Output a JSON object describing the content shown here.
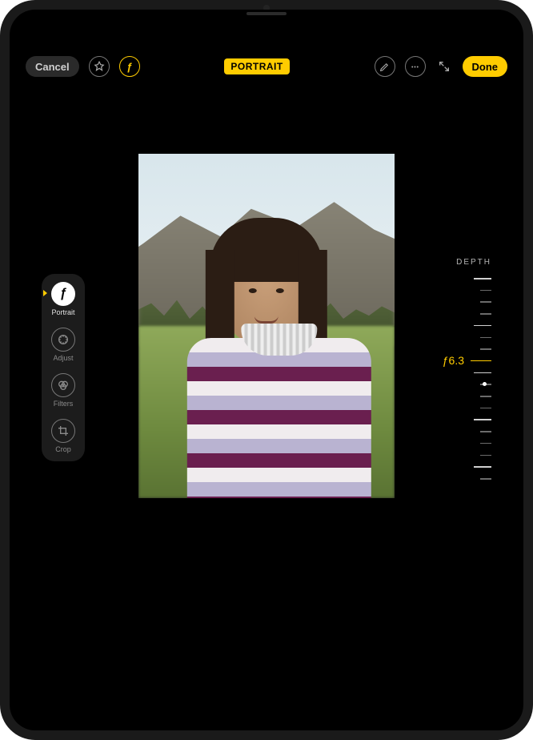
{
  "topbar": {
    "cancel": "Cancel",
    "mode_label": "PORTRAIT",
    "done": "Done"
  },
  "tools": [
    {
      "id": "portrait",
      "label": "Portrait",
      "active": true
    },
    {
      "id": "adjust",
      "label": "Adjust",
      "active": false
    },
    {
      "id": "filters",
      "label": "Filters",
      "active": false
    },
    {
      "id": "crop",
      "label": "Crop",
      "active": false
    }
  ],
  "depth": {
    "title": "DEPTH",
    "fvalue_prefix": "ƒ",
    "fvalue": "6.3",
    "tick_count": 18,
    "selected_index": 7,
    "dot_index": 9
  },
  "colors": {
    "accent": "#ffcc00"
  }
}
